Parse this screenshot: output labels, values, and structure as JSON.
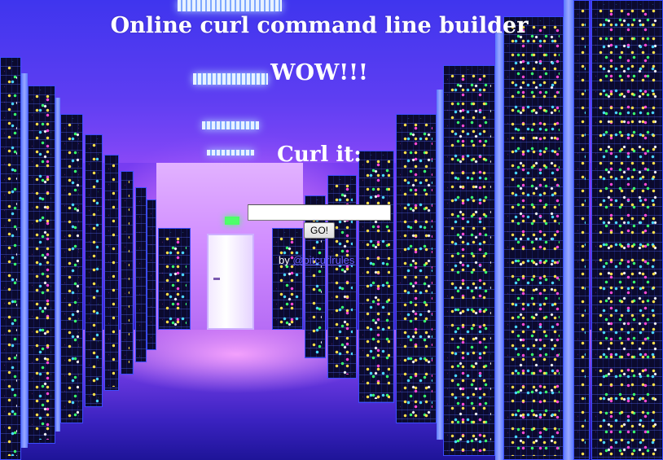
{
  "page": {
    "title": "Online curl command line builder",
    "exclamation": "WOW!!!",
    "prompt": "Curl it:"
  },
  "form": {
    "url_input_value": "",
    "go_label": "GO!"
  },
  "byline": {
    "prefix": "by",
    "author_link": "@bitcurlrules"
  },
  "colors": {
    "heading_text": "#ffffff",
    "link": "#6b5fff",
    "background_tint": "#4a38f0"
  },
  "background": {
    "scene": "server room corridor"
  }
}
